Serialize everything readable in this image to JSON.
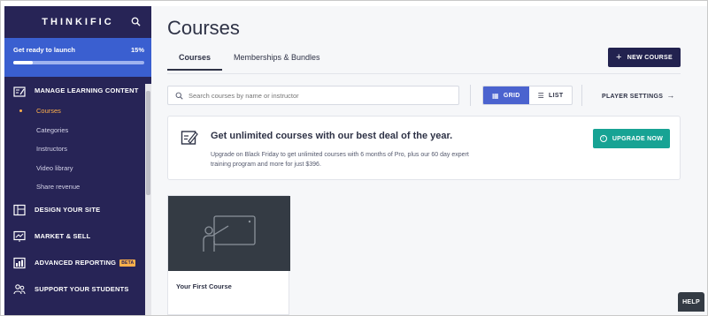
{
  "sidebar": {
    "logo": "THINKIFIC",
    "launch": {
      "label": "Get ready to launch",
      "percent_label": "15%",
      "progress": 0.15
    },
    "manage": {
      "label": "MANAGE LEARNING CONTENT",
      "items": [
        {
          "label": "Courses",
          "active": true
        },
        {
          "label": "Categories"
        },
        {
          "label": "Instructors"
        },
        {
          "label": "Video library"
        },
        {
          "label": "Share revenue"
        }
      ]
    },
    "design_label": "DESIGN YOUR SITE",
    "market_label": "MARKET & SELL",
    "reporting_label": "ADVANCED REPORTING",
    "beta_label": "BETA",
    "support_label": "SUPPORT YOUR STUDENTS",
    "icons": [
      "search-icon",
      "manage-content-icon",
      "design-site-icon",
      "market-sell-icon",
      "reporting-icon",
      "support-students-icon"
    ]
  },
  "main": {
    "title": "Courses",
    "tabs": [
      {
        "label": "Courses",
        "active": true
      },
      {
        "label": "Memberships & Bundles"
      }
    ],
    "new_course_label": "NEW COURSE",
    "search_placeholder": "Search courses by name or instructor",
    "view_toggle": {
      "grid_label": "GRID",
      "list_label": "LIST",
      "selected": "grid"
    },
    "player_settings_label": "PLAYER SETTINGS",
    "promo": {
      "heading": "Get unlimited courses with our best deal of the year.",
      "body": "Upgrade on Black Friday to get unlimited courses with 6 months of Pro, plus our 60 day expert training program and more for just $396.",
      "button_label": "UPGRADE NOW"
    },
    "courses": [
      {
        "title": "Your First Course"
      }
    ]
  },
  "help_label": "HELP",
  "colors": {
    "sidebar_bg": "#272456",
    "launch_bg": "#3a5fd0",
    "active_nav": "#ffb04b",
    "primary_button": "#22224f",
    "toggle_selected": "#4b63cf",
    "upgrade_button": "#17a394",
    "card_image_bg": "#343b44"
  }
}
